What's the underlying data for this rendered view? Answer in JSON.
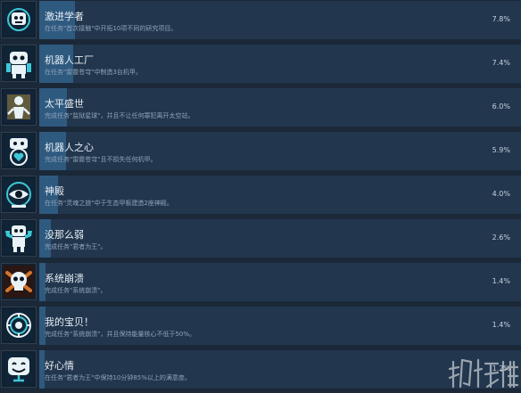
{
  "achievements": [
    {
      "title": "激进学者",
      "desc": "在任务\"首次接触\"中开拓10项不同的研究项目。",
      "percent": "7.8%",
      "value": 7.8,
      "icon": "lab-robot-icon"
    },
    {
      "title": "机器人工厂",
      "desc": "在任务\"雷霆苍穹\"中制造3台机甲。",
      "percent": "7.4%",
      "value": 7.4,
      "icon": "robot-factory-icon"
    },
    {
      "title": "太平盛世",
      "desc": "完成任务\"监狱星球\"，并且不让任何罪犯离开太空站。",
      "percent": "6.0%",
      "value": 6.0,
      "icon": "prisoner-icon"
    },
    {
      "title": "机器人之心",
      "desc": "完成任务\"雷霆苍穹\"且不损失任何机甲。",
      "percent": "5.9%",
      "value": 5.9,
      "icon": "robot-heart-icon"
    },
    {
      "title": "神殿",
      "desc": "在任务\"灵魂之旅\"中于生态甲板建造2座神殿。",
      "percent": "4.0%",
      "value": 4.0,
      "icon": "temple-eye-icon"
    },
    {
      "title": "没那么弱",
      "desc": "完成任务\"君者为王\"。",
      "percent": "2.6%",
      "value": 2.6,
      "icon": "robot-muscle-icon"
    },
    {
      "title": "系统崩溃",
      "desc": "完成任务\"系统崩溃\"。",
      "percent": "1.4%",
      "value": 1.4,
      "icon": "skull-crossbones-icon"
    },
    {
      "title": "我的宝贝！",
      "desc": "完成任务\"系统崩溃\"，并且保持能量核心不低于50%。",
      "percent": "1.4%",
      "value": 1.4,
      "icon": "energy-core-icon"
    },
    {
      "title": "好心情",
      "desc": "在任务\"君者为王\"中保持10分钟85%以上的满意度。",
      "percent": "1.2%",
      "value": 1.2,
      "icon": "happy-robot-icon"
    }
  ],
  "colors": {
    "background": "#1b2838",
    "panel": "#22374e",
    "progress": "#2f5a80",
    "icon_accent": "#3ec7d6"
  },
  "watermark": {
    "icon": "game-site-logo-icon"
  }
}
